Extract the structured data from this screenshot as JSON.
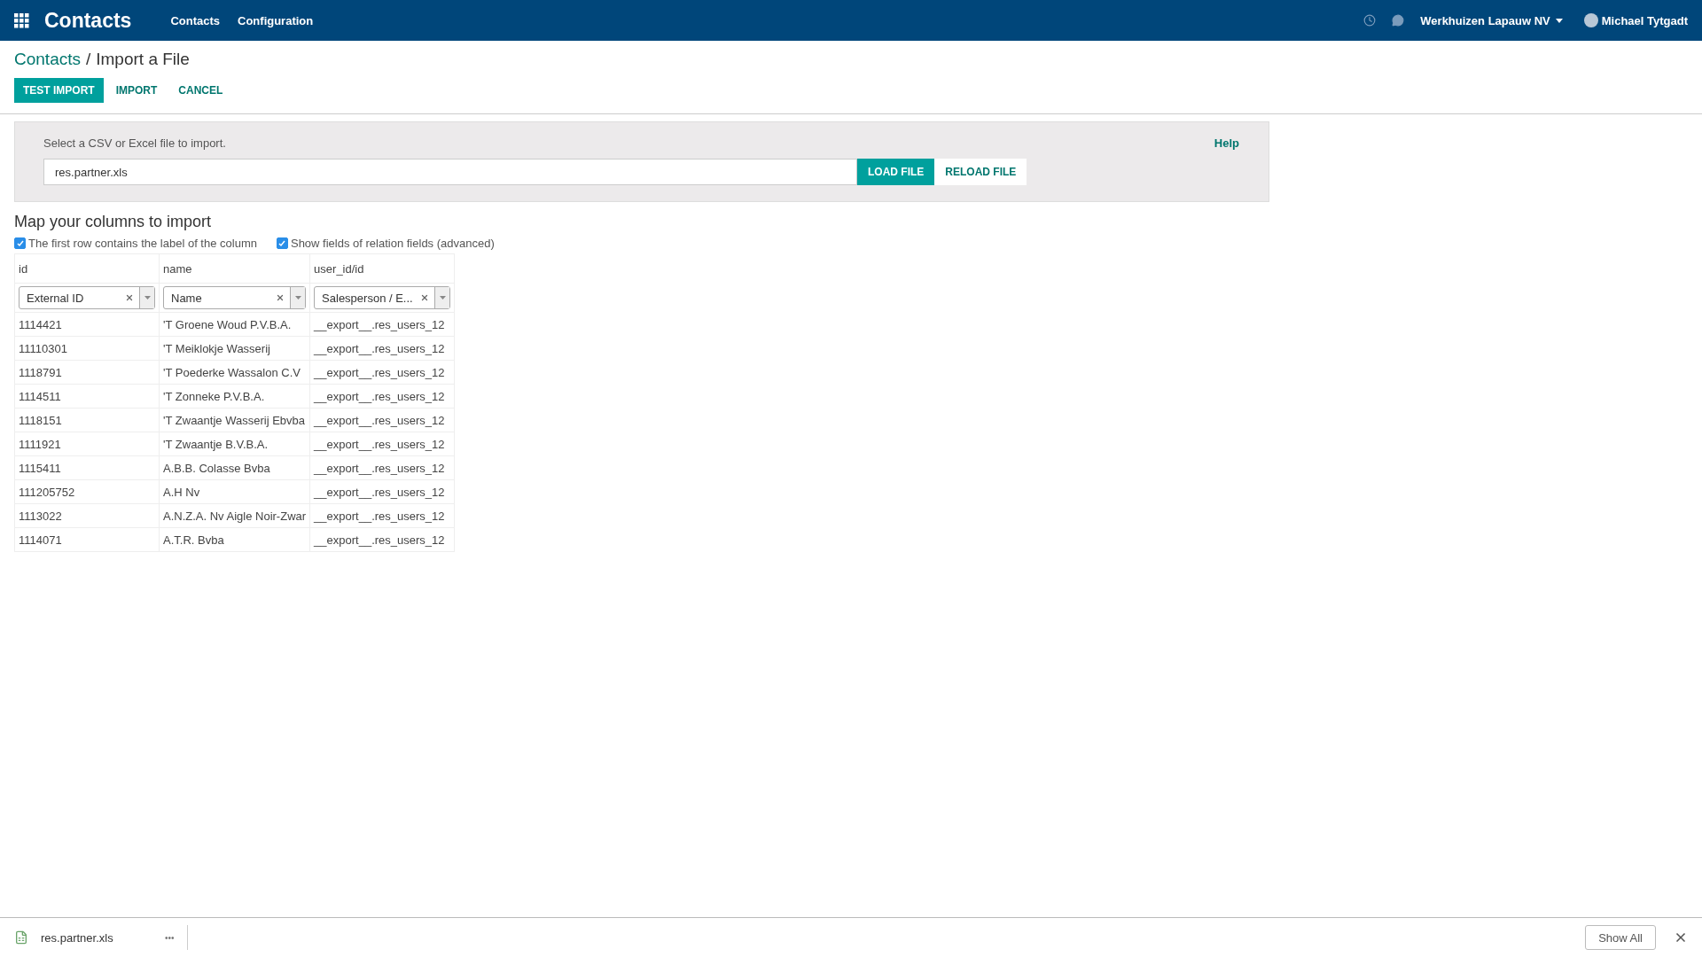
{
  "navbar": {
    "app_title": "Contacts",
    "menu": [
      "Contacts",
      "Configuration"
    ],
    "company": "Werkhuizen Lapauw NV",
    "user": "Michael Tytgadt"
  },
  "breadcrumb": {
    "parent": "Contacts",
    "separator": "/",
    "current": "Import a File"
  },
  "actions": [
    {
      "label": "TEST IMPORT",
      "kind": "primary"
    },
    {
      "label": "IMPORT",
      "kind": "link"
    },
    {
      "label": "CANCEL",
      "kind": "link"
    }
  ],
  "file_panel": {
    "prompt": "Select a CSV or Excel file to import.",
    "help": "Help",
    "file_value": "res.partner.xls",
    "load_button": "LOAD FILE",
    "reload_button": "RELOAD FILE"
  },
  "mapping": {
    "title": "Map your columns to import",
    "options": [
      {
        "label": "The first row contains the label of the column",
        "checked": true
      },
      {
        "label": "Show fields of relation fields (advanced)",
        "checked": true
      }
    ],
    "columns": [
      {
        "header": "id",
        "field": "External ID"
      },
      {
        "header": "name",
        "field": "Name"
      },
      {
        "header": "user_id/id",
        "field": "Salesperson / E..."
      }
    ],
    "rows": [
      [
        "1114421",
        "'T Groene Woud P.V.B.A.",
        "__export__.res_users_12"
      ],
      [
        "11110301",
        "'T Meiklokje Wasserij",
        "__export__.res_users_12"
      ],
      [
        "1118791",
        "'T Poederke Wassalon C.V",
        "__export__.res_users_12"
      ],
      [
        "1114511",
        "'T Zonneke P.V.B.A.",
        "__export__.res_users_12"
      ],
      [
        "1118151",
        "'T Zwaantje Wasserij Ebvba",
        "__export__.res_users_12"
      ],
      [
        "1111921",
        "'T Zwaantje B.V.B.A.",
        "__export__.res_users_12"
      ],
      [
        "1115411",
        "A.B.B. Colasse Bvba",
        "__export__.res_users_12"
      ],
      [
        "111205752",
        "A.H Nv",
        "__export__.res_users_12"
      ],
      [
        "1113022",
        "A.N.Z.A. Nv Aigle Noir-Zwar",
        "__export__.res_users_12"
      ],
      [
        "1114071",
        "A.T.R. Bvba",
        "__export__.res_users_12"
      ]
    ]
  },
  "download_bar": {
    "file_name": "res.partner.xls",
    "more": "•••",
    "show_all": "Show All"
  }
}
